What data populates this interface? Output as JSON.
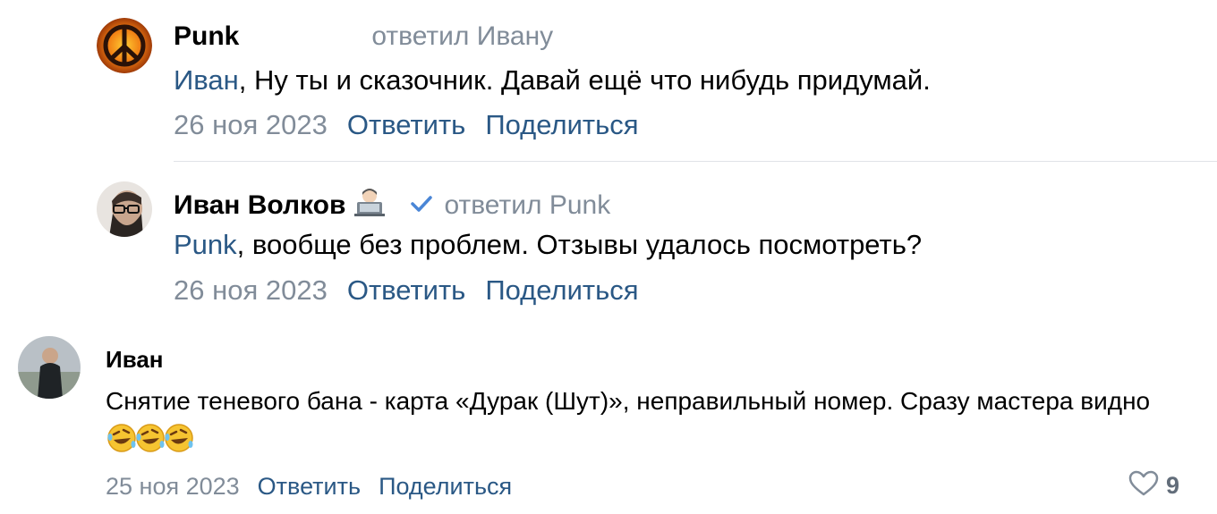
{
  "comments": [
    {
      "author": "Punk",
      "replied_to": "ответил Ивану",
      "mention": "Иван",
      "text": ", Ну ты и сказочник. Давай ещё что нибудь придумай.",
      "date": "26 ноя 2023",
      "reply_label": "Ответить",
      "share_label": "Поделиться"
    },
    {
      "author": "Иван Волков",
      "verified_icon": "checkmark-icon",
      "replied_to": "ответил Punk",
      "mention": "Punk",
      "text": ", вообще без проблем. Отзывы удалось посмотреть?",
      "date": "26 ноя 2023",
      "reply_label": "Ответить",
      "share_label": "Поделиться"
    },
    {
      "author": "Иван",
      "text": "Снятие теневого бана - карта «Дурак (Шут)», неправильный номер. Сразу мастера видно",
      "date": "25 ноя 2023",
      "reply_label": "Ответить",
      "share_label": "Поделиться",
      "likes": "9",
      "like_icon": "heart-outline-icon"
    }
  ],
  "colors": {
    "link": "#2a5885",
    "secondary": "#818c99",
    "verified": "#4a86d6"
  }
}
